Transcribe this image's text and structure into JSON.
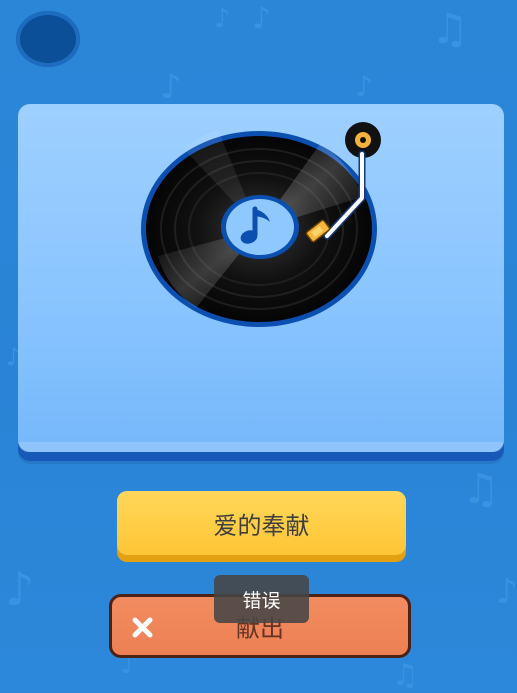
{
  "background": {
    "color": "#2b86d8",
    "icon": "music-note-icon"
  },
  "top_status": {
    "icon": "progress-dot-icon",
    "color": "#0a4f98"
  },
  "card": {
    "icon": "record-player-icon"
  },
  "answer_button": {
    "label": "爱的奉献"
  },
  "submit_button": {
    "label": "献出",
    "icon": "close-icon",
    "color": "#ec8054"
  },
  "toast": {
    "message": "错误"
  }
}
